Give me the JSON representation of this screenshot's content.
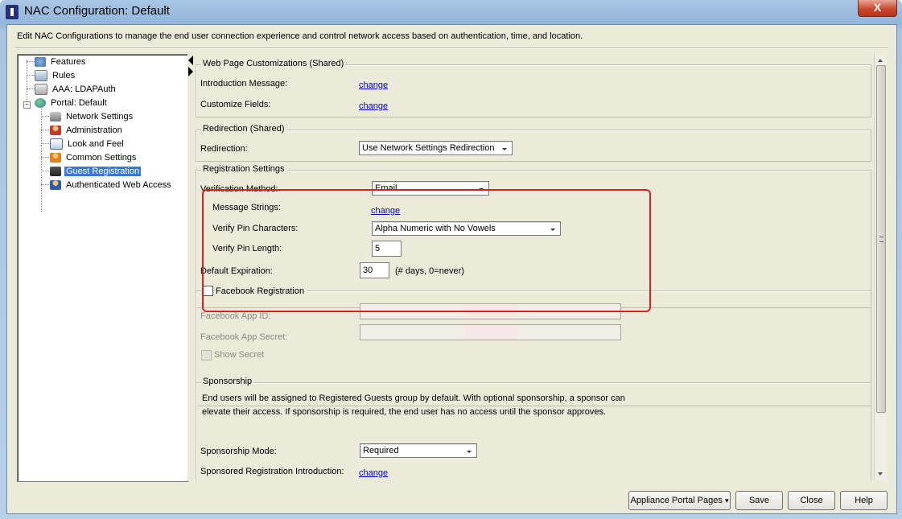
{
  "window": {
    "title": "NAC Configuration: Default",
    "close_label": "X"
  },
  "description": "Edit NAC Configurations to manage the end user connection experience and control network access based on authentication, time, and location.",
  "tree": {
    "items": [
      {
        "label": "Features",
        "icon": "features-icon"
      },
      {
        "label": "Rules",
        "icon": "rules-icon"
      },
      {
        "label": "AAA: LDAPAuth",
        "icon": "aaa-icon"
      },
      {
        "label": "Portal: Default",
        "icon": "globe-icon"
      },
      {
        "label": "Network Settings",
        "icon": "network-icon"
      },
      {
        "label": "Administration",
        "icon": "admin-icon"
      },
      {
        "label": "Look and Feel",
        "icon": "look-feel-icon"
      },
      {
        "label": "Common Settings",
        "icon": "common-settings-icon"
      },
      {
        "label": "Guest Registration",
        "icon": "guest-registration-icon",
        "selected": true
      },
      {
        "label": "Authenticated Web Access",
        "icon": "web-access-icon"
      }
    ],
    "expander": "−"
  },
  "web_page": {
    "title": "Web Page Customizations (Shared)",
    "intro_label": "Introduction Message:",
    "intro_link": "change",
    "customize_label": "Customize Fields:",
    "customize_link": "change"
  },
  "redirection": {
    "title": "Redirection (Shared)",
    "label": "Redirection:",
    "value": "Use Network Settings Redirection"
  },
  "registration": {
    "title": "Registration Settings",
    "verification_label": "Verification Method:",
    "verification_value": "Email",
    "message_strings_label": "Message Strings:",
    "message_strings_link": "change",
    "pin_chars_label": "Verify Pin Characters:",
    "pin_chars_value": "Alpha Numeric with No Vowels",
    "pin_length_label": "Verify Pin Length:",
    "pin_length_value": "5",
    "expiration_label": "Default Expiration:",
    "expiration_value": "30",
    "expiration_hint": "(# days, 0=never)"
  },
  "facebook": {
    "title": "Facebook Registration",
    "app_id_label": "Facebook App ID:",
    "app_secret_label": "Facebook App Secret:",
    "show_secret_label": "Show Secret"
  },
  "sponsorship": {
    "title": "Sponsorship",
    "text_line1": "End users will be assigned to Registered Guests group by default. With optional sponsorship, a sponsor can",
    "text_line2": "elevate their access. If sponsorship is required, the end user has no access until the sponsor approves.",
    "mode_label": "Sponsorship Mode:",
    "mode_value": "Required",
    "intro_label": "Sponsored Registration Introduction:",
    "intro_link": "change"
  },
  "buttons": {
    "appliance": "Appliance Portal Pages",
    "save": "Save",
    "close": "Close",
    "help": "Help"
  },
  "colors": {
    "highlight": "#d32424",
    "selection": "#3a78d6",
    "link": "#0000cc"
  }
}
